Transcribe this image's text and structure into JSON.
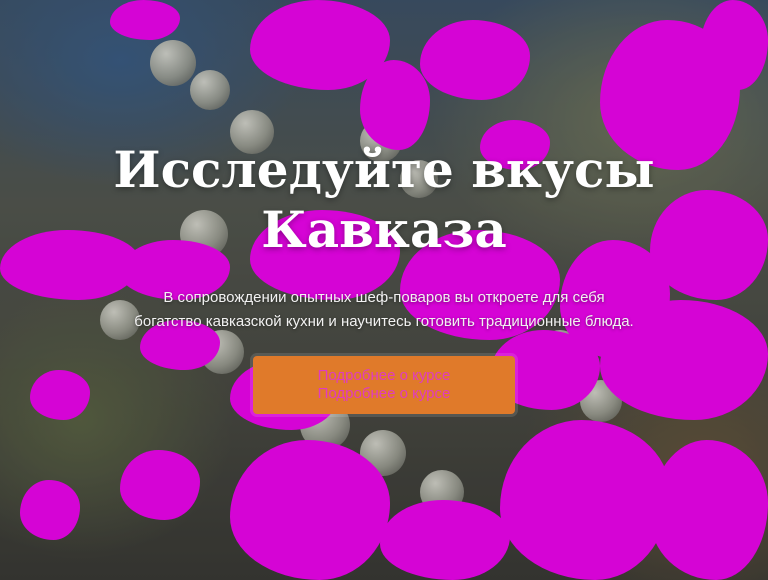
{
  "hero": {
    "title": "Исследуйте вкусы Кавказа",
    "subtitle": "В сопровождении опытных шеф-поваров вы откроете для себя богатство кавказской кухни и научитесь готовить традиционные блюда.",
    "button_label": "Подробнее о курсе",
    "button_label_duplicate": "Подробнее о курсе"
  },
  "colors": {
    "button_background": "#e07a2a",
    "button_text": "#e03cbf",
    "mask_overlay": "#ff00ff"
  }
}
